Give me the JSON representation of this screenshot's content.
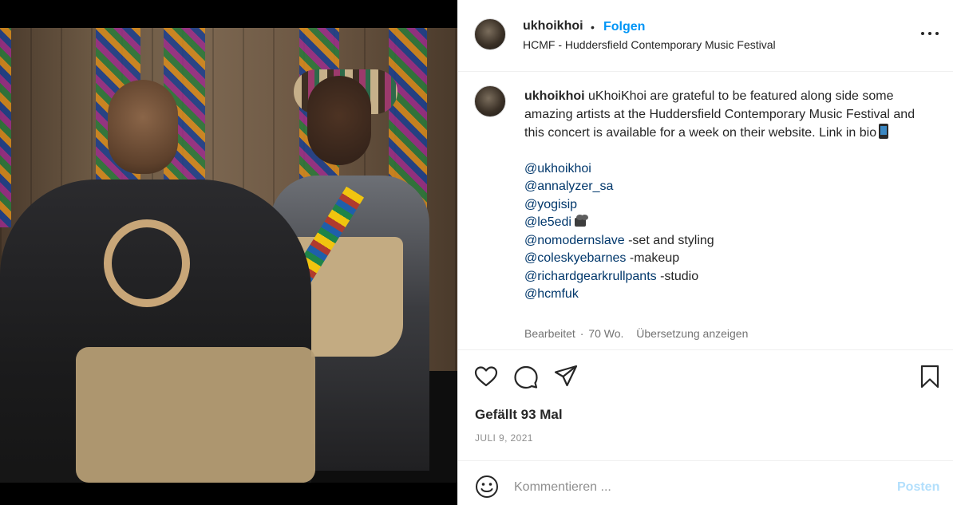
{
  "post": {
    "username": "ukhoikhoi",
    "separator": "•",
    "follow_label": "Folgen",
    "location": "HCMF - Huddersfield Contemporary Music Festival",
    "caption": {
      "username": "ukhoikhoi",
      "text": "uKhoiKhoi are grateful to be featured along side some amazing artists at the Huddersfield Contemporary Music Festival and this concert is available for a week on their website. Link in bio",
      "mentions": [
        {
          "handle": "@ukhoikhoi",
          "suffix": ""
        },
        {
          "handle": "@annalyzer_sa",
          "suffix": ""
        },
        {
          "handle": "@yogisip",
          "suffix": ""
        },
        {
          "handle": "@le5edi",
          "suffix": ""
        },
        {
          "handle": "@nomodernslave",
          "suffix": " -set and styling"
        },
        {
          "handle": "@coleskyebarnes",
          "suffix": " -makeup"
        },
        {
          "handle": "@richardgearkrullpants",
          "suffix": " -studio"
        },
        {
          "handle": "@hcmfuk",
          "suffix": ""
        }
      ],
      "edited_label": "Bearbeitet",
      "meta_separator": "·",
      "age": "70 Wo.",
      "translate_label": "Übersetzung anzeigen"
    },
    "likes_text": "Gefällt 93 Mal",
    "date": "JULI 9, 2021",
    "comment_placeholder": "Kommentieren ...",
    "post_button_label": "Posten",
    "icons": [
      "more-options-icon",
      "heart-icon",
      "comment-icon",
      "share-icon",
      "bookmark-icon",
      "emoji-icon"
    ],
    "colors": {
      "link_blue": "#0095f6",
      "mention_blue": "#00376b",
      "muted": "#737373",
      "post_disabled": "#b2dffc"
    }
  }
}
